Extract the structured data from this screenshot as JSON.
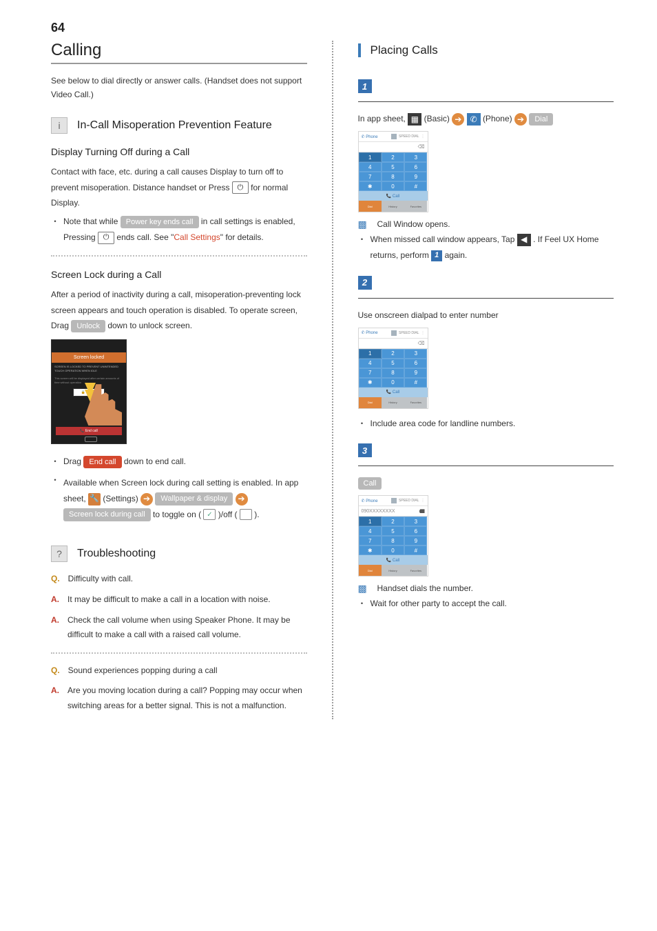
{
  "page_number": "64",
  "left": {
    "h1": "Calling",
    "intro": "See below to dial directly or answer calls. (Handset does not support Video Call.)",
    "sec1": {
      "icon": "i",
      "title": "In-Call Misoperation Prevention Feature",
      "sub1": {
        "title": "Display Turning Off during a Call",
        "body_a": "Contact with face, etc. during a call causes Display to turn off to prevent misoperation. Distance handset or Press ",
        "key": "⏻",
        "body_b": " for normal Display.",
        "note_a": "Note that while ",
        "pill": "Power key ends call",
        "note_b": " in call settings is enabled, Pressing ",
        "note_c": " ends call. See \"",
        "link": "Call Settings",
        "note_d": "\" for details."
      },
      "sub2": {
        "title": "Screen Lock during a Call",
        "body_a": "After a period of inactivity during a call, misoperation-preventing lock screen appears and touch operation is disabled. To operate screen, Drag ",
        "pill_unlock": "Unlock",
        "body_b": " down to unlock screen.",
        "lock_title": "Screen locked",
        "lock_txt1": "SCREEN IS LOCKED TO PREVENT UNINTENDED TOUCH OPERATION WHEN IDLE",
        "lock_txt2": "This screen will be displayed after certain amounts of time without operation",
        "lock_unlock": "🔒  Unlock",
        "lock_end": "📞   End call",
        "note2_a": "Drag ",
        "pill_end": "End call",
        "note2_b": " down to end call.",
        "note3_a": "Available when Screen lock during call setting is enabled. In app sheet, ",
        "settings": " (Settings) ",
        "pill_wall": "Wallpaper & display",
        "pill_slock": "Screen lock during call",
        "toggle_a": " to toggle on ( ",
        "check": "✓",
        "toggle_b": " )/off ( ",
        "toggle_c": " )."
      }
    },
    "sec2": {
      "icon": "?",
      "title": "Troubleshooting",
      "qa": [
        {
          "tag": "Q",
          "text": "Difficulty with call."
        },
        {
          "tag": "A",
          "text": "It may be difficult to make a call in a location with noise."
        },
        {
          "tag": "A",
          "text": "Check the call volume when using Speaker Phone. It may be difficult to make a call with a raised call volume."
        },
        {
          "tag": "Q",
          "text": "Sound experiences popping during a call"
        },
        {
          "tag": "A",
          "text": "Are you moving location during a call? Popping may occur when switching areas for a better signal. This is not a malfunction."
        }
      ]
    }
  },
  "right": {
    "title": "Placing Calls",
    "step1": {
      "num": "1",
      "line_a": "In app sheet, ",
      "basic": " (Basic) ",
      "phone": " (Phone) ",
      "pill_dial": "Dial",
      "result": "Call Window opens.",
      "note_a": "When missed call window appears, Tap ",
      "note_b": ". If Feel UX Home returns, perform ",
      "note_c": " again."
    },
    "step2": {
      "num": "2",
      "line": "Use onscreen dialpad to enter number",
      "note": "Include area code for landline numbers."
    },
    "step3": {
      "num": "3",
      "pill": "Call",
      "entered": "090XXXXXXXX",
      "result": "Handset dials the number.",
      "note": "Wait for other party to accept the call."
    },
    "shot": {
      "app": "Phone",
      "speed": "SPEED\nDIAL",
      "menu": "⋮",
      "delhint": "⌫",
      "keys": [
        "1",
        "2",
        "3",
        "4",
        "5",
        "6",
        "7",
        "8",
        "9",
        "✱",
        "0",
        "#"
      ],
      "call": "📞 Call",
      "tabs": [
        "Dial",
        "History",
        "Favorites"
      ]
    }
  }
}
